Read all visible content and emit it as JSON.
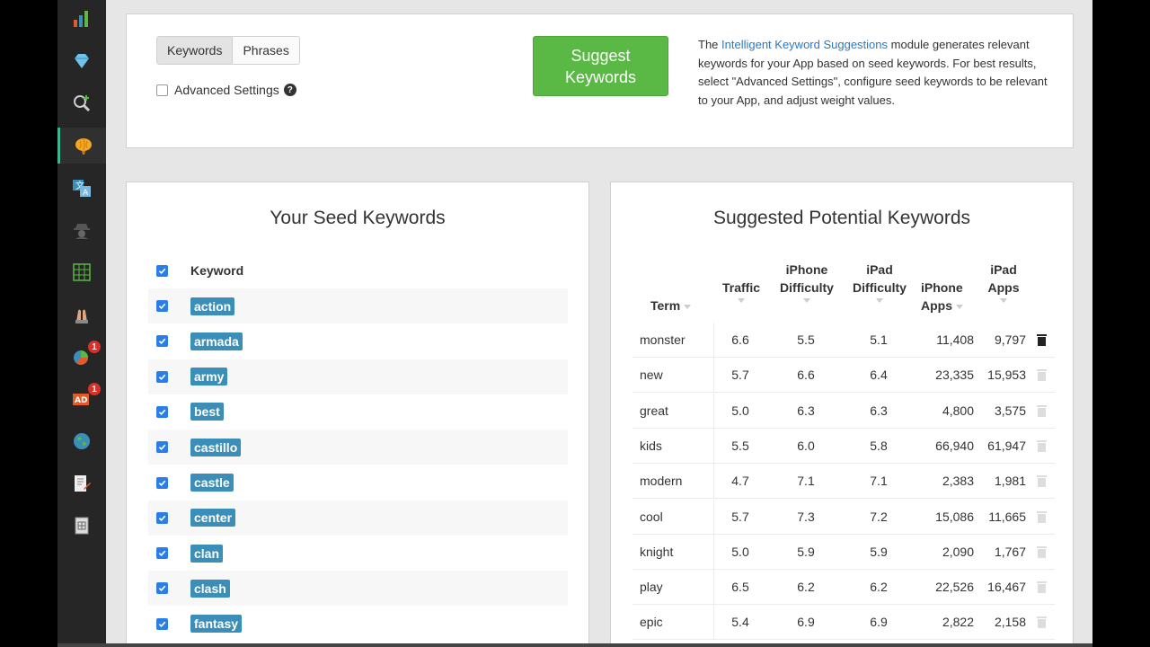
{
  "sidebar": {
    "items": [
      {
        "icon": "bar-chart-icon",
        "badge": ""
      },
      {
        "icon": "diamond-icon",
        "badge": ""
      },
      {
        "icon": "keyword-search-icon",
        "badge": ""
      },
      {
        "icon": "brain-icon",
        "badge": "",
        "active": true
      },
      {
        "icon": "translate-icon",
        "badge": ""
      },
      {
        "icon": "spy-icon",
        "badge": ""
      },
      {
        "icon": "grid-icon",
        "badge": ""
      },
      {
        "icon": "hands-icon",
        "badge": ""
      },
      {
        "icon": "pie-chart-icon",
        "badge": "1"
      },
      {
        "icon": "ad-icon",
        "badge": "1"
      },
      {
        "icon": "globe-icon",
        "badge": ""
      },
      {
        "icon": "edit-document-icon",
        "badge": ""
      },
      {
        "icon": "report-icon",
        "badge": ""
      }
    ]
  },
  "top": {
    "tabs": [
      "Keywords",
      "Phrases"
    ],
    "advanced_label": "Advanced Settings",
    "help": "?",
    "suggest_line1": "Suggest",
    "suggest_line2": "Keywords",
    "info_prefix": "The ",
    "info_link": "Intelligent Keyword Suggestions",
    "info_suffix": " module generates relevant keywords for your App based on seed keywords. For best results, select \"Advanced Settings\", configure seed keywords to be relevant to your App, and adjust weight values."
  },
  "seed": {
    "title": "Your Seed Keywords",
    "header": "Keyword",
    "keywords": [
      "action",
      "armada",
      "army",
      "best",
      "castillo",
      "castle",
      "center",
      "clan",
      "clash",
      "fantasy"
    ]
  },
  "suggested": {
    "title": "Suggested Potential Keywords",
    "headers": {
      "term": "Term",
      "traffic": "Traffic",
      "iphone_diff_1": "iPhone",
      "iphone_diff_2": "Difficulty",
      "ipad_diff_1": "iPad",
      "ipad_diff_2": "Difficulty",
      "iphone_apps_1": "iPhone",
      "iphone_apps_2": "Apps",
      "ipad_apps_1": "iPad",
      "ipad_apps_2": "Apps"
    },
    "rows": [
      {
        "term": "monster",
        "traffic": "6.6",
        "iphone_diff": "5.5",
        "ipad_diff": "5.1",
        "iphone_apps": "11,408",
        "ipad_apps": "9,797"
      },
      {
        "term": "new",
        "traffic": "5.7",
        "iphone_diff": "6.6",
        "ipad_diff": "6.4",
        "iphone_apps": "23,335",
        "ipad_apps": "15,953"
      },
      {
        "term": "great",
        "traffic": "5.0",
        "iphone_diff": "6.3",
        "ipad_diff": "6.3",
        "iphone_apps": "4,800",
        "ipad_apps": "3,575"
      },
      {
        "term": "kids",
        "traffic": "5.5",
        "iphone_diff": "6.0",
        "ipad_diff": "5.8",
        "iphone_apps": "66,940",
        "ipad_apps": "61,947"
      },
      {
        "term": "modern",
        "traffic": "4.7",
        "iphone_diff": "7.1",
        "ipad_diff": "7.1",
        "iphone_apps": "2,383",
        "ipad_apps": "1,981"
      },
      {
        "term": "cool",
        "traffic": "5.7",
        "iphone_diff": "7.3",
        "ipad_diff": "7.2",
        "iphone_apps": "15,086",
        "ipad_apps": "11,665"
      },
      {
        "term": "knight",
        "traffic": "5.0",
        "iphone_diff": "5.9",
        "ipad_diff": "5.9",
        "iphone_apps": "2,090",
        "ipad_apps": "1,767"
      },
      {
        "term": "play",
        "traffic": "6.5",
        "iphone_diff": "6.2",
        "ipad_diff": "6.2",
        "iphone_apps": "22,526",
        "ipad_apps": "16,467"
      },
      {
        "term": "epic",
        "traffic": "5.4",
        "iphone_diff": "6.9",
        "ipad_diff": "6.9",
        "iphone_apps": "2,822",
        "ipad_apps": "2,158"
      }
    ]
  },
  "colors": {
    "accent": "#59b944",
    "tag": "#3b8eb8",
    "link": "#2a7ac4",
    "checkbox": "#2b7de9",
    "badge": "#d9302a"
  }
}
